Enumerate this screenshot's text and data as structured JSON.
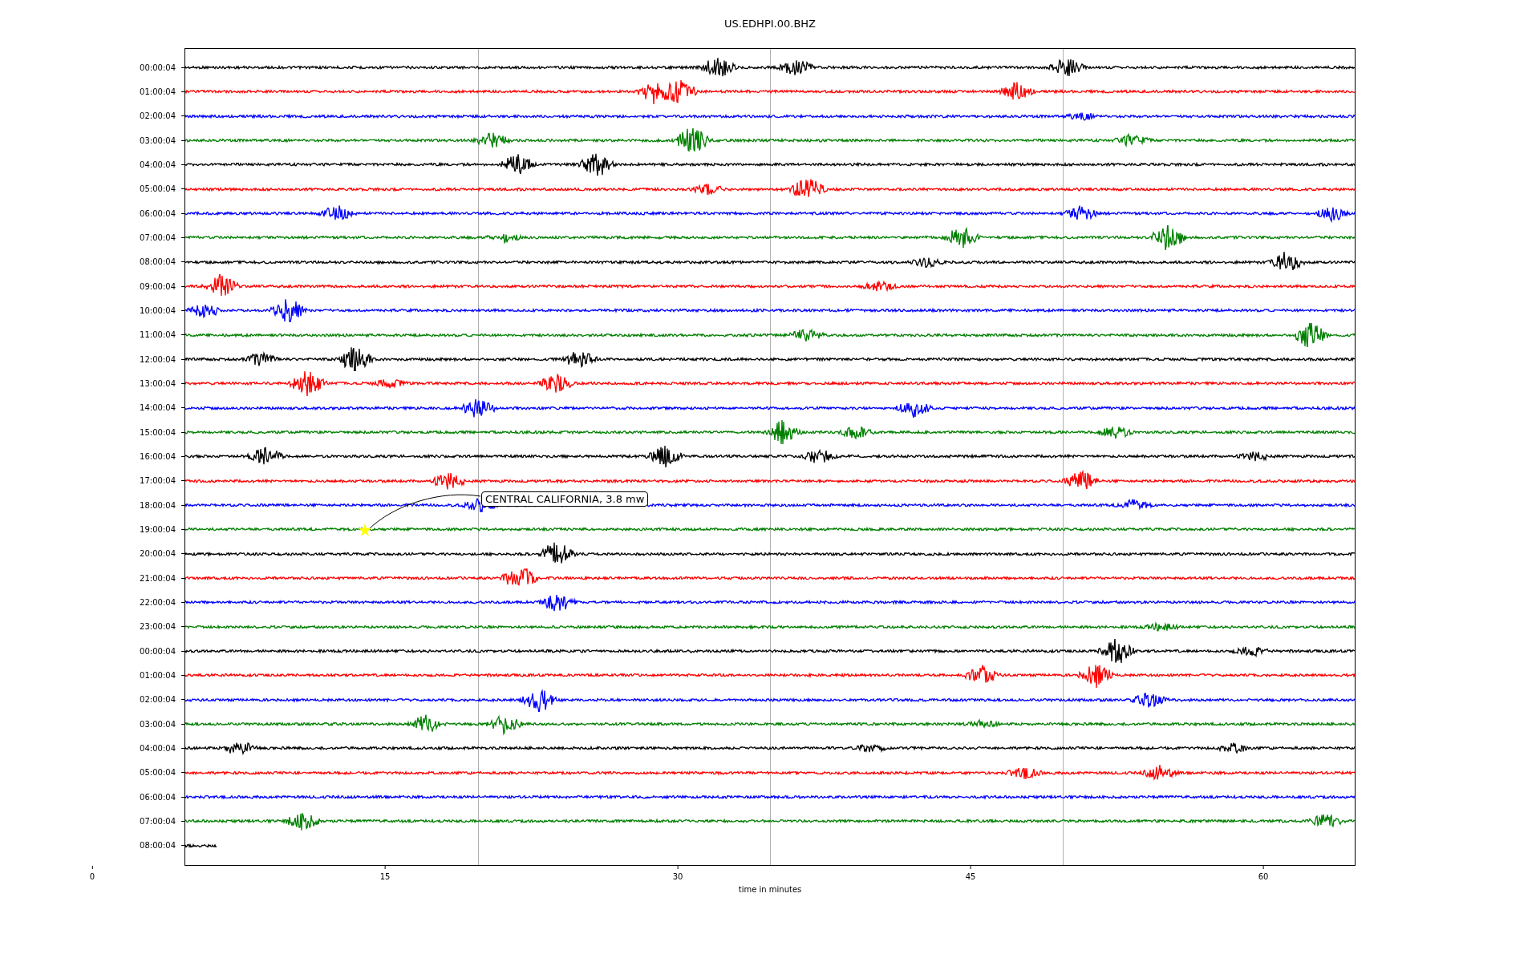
{
  "title": "US.EDHPI.00.BHZ",
  "traces": [
    {
      "label": "00:00:04",
      "color": "#000000",
      "partial": false
    },
    {
      "label": "01:00:04",
      "color": "#ff0000",
      "partial": false
    },
    {
      "label": "02:00:04",
      "color": "#0000ff",
      "partial": false
    },
    {
      "label": "03:00:04",
      "color": "#008000",
      "partial": false
    },
    {
      "label": "04:00:04",
      "color": "#000000",
      "partial": false
    },
    {
      "label": "05:00:04",
      "color": "#ff0000",
      "partial": false
    },
    {
      "label": "06:00:04",
      "color": "#0000ff",
      "partial": false
    },
    {
      "label": "07:00:04",
      "color": "#008000",
      "partial": false
    },
    {
      "label": "08:00:04",
      "color": "#000000",
      "partial": false
    },
    {
      "label": "09:00:04",
      "color": "#ff0000",
      "partial": false
    },
    {
      "label": "10:00:04",
      "color": "#0000ff",
      "partial": false
    },
    {
      "label": "11:00:04",
      "color": "#008000",
      "partial": false
    },
    {
      "label": "12:00:04",
      "color": "#000000",
      "partial": false
    },
    {
      "label": "13:00:04",
      "color": "#ff0000",
      "partial": false
    },
    {
      "label": "14:00:04",
      "color": "#0000ff",
      "partial": false
    },
    {
      "label": "15:00:04",
      "color": "#008000",
      "partial": false
    },
    {
      "label": "16:00:04",
      "color": "#000000",
      "partial": false
    },
    {
      "label": "17:00:04",
      "color": "#ff0000",
      "partial": false
    },
    {
      "label": "18:00:04",
      "color": "#0000ff",
      "partial": false
    },
    {
      "label": "19:00:04",
      "color": "#008000",
      "partial": false
    },
    {
      "label": "20:00:04",
      "color": "#000000",
      "partial": false
    },
    {
      "label": "21:00:04",
      "color": "#ff0000",
      "partial": false
    },
    {
      "label": "22:00:04",
      "color": "#0000ff",
      "partial": false
    },
    {
      "label": "23:00:04",
      "color": "#008000",
      "partial": false
    },
    {
      "label": "00:00:04",
      "color": "#000000",
      "partial": false
    },
    {
      "label": "01:00:04",
      "color": "#ff0000",
      "partial": false
    },
    {
      "label": "02:00:04",
      "color": "#0000ff",
      "partial": false
    },
    {
      "label": "03:00:04",
      "color": "#008000",
      "partial": false
    },
    {
      "label": "04:00:04",
      "color": "#000000",
      "partial": false
    },
    {
      "label": "05:00:04",
      "color": "#ff0000",
      "partial": false
    },
    {
      "label": "06:00:04",
      "color": "#0000ff",
      "partial": false
    },
    {
      "label": "07:00:04",
      "color": "#008000",
      "partial": false
    },
    {
      "label": "08:00:04",
      "color": "#000000",
      "partial": true
    }
  ],
  "x_ticks": [
    "0",
    "15",
    "30",
    "45",
    "60"
  ],
  "xlabel": "time in minutes",
  "annotation": {
    "text": "CENTRAL CALIFORNIA, 3.8 mw"
  }
}
